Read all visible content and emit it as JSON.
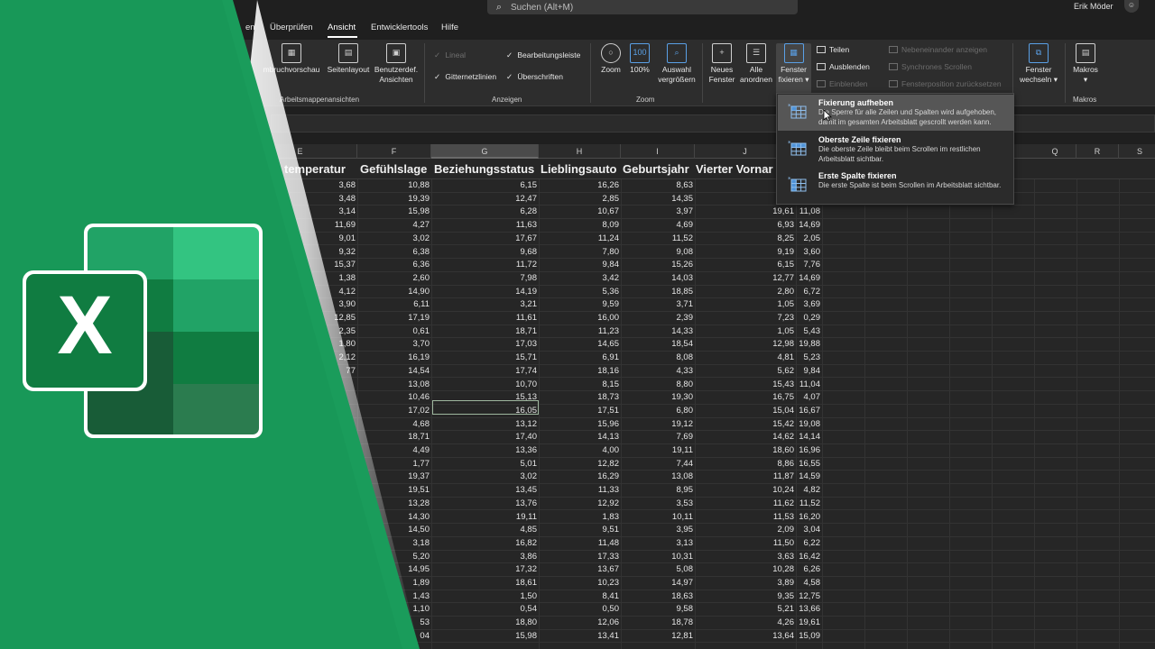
{
  "titlebar": {
    "search_placeholder": "Suchen (Alt+M)",
    "user_name": "Erik Möder"
  },
  "tabs": [
    {
      "label": "en",
      "active": false
    },
    {
      "label": "Überprüfen",
      "active": false
    },
    {
      "label": "Ansicht",
      "active": true
    },
    {
      "label": "Entwicklertools",
      "active": false
    },
    {
      "label": "Hilfe",
      "active": false
    }
  ],
  "ribbon": {
    "workbook_views": {
      "label": "Arbeitsmappenansichten",
      "page_break": "mbruchvorschau",
      "page_layout": "Seitenlayout",
      "custom_views_1": "Benutzerdef.",
      "custom_views_2": "Ansichten"
    },
    "show": {
      "label": "Anzeigen",
      "ruler": "Lineal",
      "gridlines": "Gitternetzlinien",
      "formula_bar": "Bearbeitungsleiste",
      "headings": "Überschriften"
    },
    "zoom": {
      "label": "Zoom",
      "zoom": "Zoom",
      "hundred": "100%",
      "selection_1": "Auswahl",
      "selection_2": "vergrößern"
    },
    "window": {
      "new_window_1": "Neues",
      "new_window_2": "Fenster",
      "arrange_all_1": "Alle",
      "arrange_all_2": "anordnen",
      "freeze_1": "Fenster",
      "freeze_2": "fixieren ▾",
      "split": "Teilen",
      "hide": "Ausblenden",
      "unhide": "Einblenden",
      "side_by_side": "Nebeneinander anzeigen",
      "sync_scroll": "Synchrones Scrollen",
      "reset_position": "Fensterposition zurücksetzen",
      "switch_1": "Fenster",
      "switch_2": "wechseln ▾"
    },
    "macros": {
      "label": "Makros",
      "macros_1": "Makros",
      "macros_2": "▾"
    }
  },
  "menu": {
    "items": [
      {
        "title": "Fixierung aufheben",
        "desc": "Die Sperre für alle Zeilen und Spalten wird aufgehoben, damit im gesamten Arbeitsblatt gescrollt werden kann."
      },
      {
        "title": "Oberste Zeile fixieren",
        "desc": "Die oberste Zeile bleibt beim Scrollen im restlichen Arbeitsblatt sichtbar."
      },
      {
        "title": "Erste Spalte fixieren",
        "desc": "Die erste Spalte ist beim Scrollen im Arbeitsblatt sichtbar."
      }
    ]
  },
  "sheet": {
    "column_letters": [
      "E",
      "F",
      "G",
      "H",
      "I",
      "J",
      "Q",
      "R",
      "S"
    ],
    "headers": [
      "temperatur",
      "Gefühlslage",
      "Beziehungsstatus",
      "Lieblingsauto",
      "Geburtsjahr",
      "Vierter Vornar"
    ],
    "rows": [
      [
        "3,68",
        "10,88",
        "6,15",
        "16,26",
        "8,63",
        "1",
        ""
      ],
      [
        "3,48",
        "19,39",
        "12,47",
        "2,85",
        "14,35",
        "",
        ""
      ],
      [
        "3,14",
        "15,98",
        "6,28",
        "10,67",
        "3,97",
        "19,61",
        "11,08"
      ],
      [
        "11,69",
        "4,27",
        "11,63",
        "8,09",
        "4,69",
        "6,93",
        "14,69"
      ],
      [
        "9,01",
        "3,02",
        "17,67",
        "11,24",
        "11,52",
        "8,25",
        "2,05"
      ],
      [
        "9,32",
        "6,38",
        "9,68",
        "7,80",
        "9,08",
        "9,19",
        "3,60"
      ],
      [
        "15,37",
        "6,36",
        "11,72",
        "9,84",
        "15,26",
        "6,15",
        "7,76"
      ],
      [
        "1,38",
        "2,60",
        "7,98",
        "3,42",
        "14,03",
        "12,77",
        "14,69"
      ],
      [
        "4,12",
        "14,90",
        "14,19",
        "5,36",
        "18,85",
        "2,80",
        "6,72"
      ],
      [
        "3,90",
        "6,11",
        "3,21",
        "9,59",
        "3,71",
        "1,05",
        "3,69"
      ],
      [
        "12,85",
        "17,19",
        "11,61",
        "16,00",
        "2,39",
        "7,23",
        "0,29"
      ],
      [
        "2,35",
        "0,61",
        "18,71",
        "11,23",
        "14,33",
        "1,05",
        "5,43"
      ],
      [
        "1,80",
        "3,70",
        "17,03",
        "14,65",
        "18,54",
        "12,98",
        "19,88"
      ],
      [
        "2,12",
        "16,19",
        "15,71",
        "6,91",
        "8,08",
        "4,81",
        "5,23"
      ],
      [
        "77",
        "14,54",
        "17,74",
        "18,16",
        "4,33",
        "5,62",
        "9,84"
      ],
      [
        "",
        "13,08",
        "10,70",
        "8,15",
        "8,80",
        "15,43",
        "11,04"
      ],
      [
        "",
        "10,46",
        "15,13",
        "18,73",
        "19,30",
        "16,75",
        "4,07"
      ],
      [
        "",
        "17,02",
        "16,05",
        "17,51",
        "6,80",
        "15,04",
        "16,67"
      ],
      [
        "",
        "4,68",
        "13,12",
        "15,96",
        "19,12",
        "15,42",
        "19,08"
      ],
      [
        "",
        "18,71",
        "17,40",
        "14,13",
        "7,69",
        "14,62",
        "14,14"
      ],
      [
        "",
        "4,49",
        "13,36",
        "4,00",
        "19,11",
        "18,60",
        "16,96"
      ],
      [
        "",
        "1,77",
        "5,01",
        "12,82",
        "7,44",
        "8,86",
        "16,55"
      ],
      [
        "",
        "19,37",
        "3,02",
        "16,29",
        "13,08",
        "11,87",
        "14,59"
      ],
      [
        "",
        "19,51",
        "13,45",
        "11,33",
        "8,95",
        "10,24",
        "4,82"
      ],
      [
        "",
        "13,28",
        "13,76",
        "12,92",
        "3,53",
        "11,62",
        "11,52"
      ],
      [
        "",
        "14,30",
        "19,11",
        "1,83",
        "10,11",
        "11,53",
        "16,20"
      ],
      [
        "",
        "14,50",
        "4,85",
        "9,51",
        "3,95",
        "2,09",
        "3,04"
      ],
      [
        "",
        "3,18",
        "16,82",
        "11,48",
        "3,13",
        "11,50",
        "6,22"
      ],
      [
        "",
        "5,20",
        "3,86",
        "17,33",
        "10,31",
        "3,63",
        "16,42"
      ],
      [
        "",
        "14,95",
        "17,32",
        "13,67",
        "5,08",
        "10,28",
        "6,26"
      ],
      [
        "",
        "1,89",
        "18,61",
        "10,23",
        "14,97",
        "3,89",
        "4,58"
      ],
      [
        "",
        "1,43",
        "1,50",
        "8,41",
        "18,63",
        "9,35",
        "12,75"
      ],
      [
        "",
        "1,10",
        "0,54",
        "0,50",
        "9,58",
        "5,21",
        "13,66"
      ],
      [
        "",
        "53",
        "18,80",
        "12,06",
        "18,78",
        "4,26",
        "19,61"
      ],
      [
        "",
        "04",
        "15,98",
        "13,41",
        "12,81",
        "13,64",
        "15,09"
      ]
    ]
  },
  "logo": {
    "letter": "X"
  },
  "colors": {
    "excel_green": "#1a9c5b",
    "logo_dark": "#185c37",
    "logo_mid": "#21a366",
    "logo_light": "#33c481",
    "logo_badge": "#107c41"
  }
}
